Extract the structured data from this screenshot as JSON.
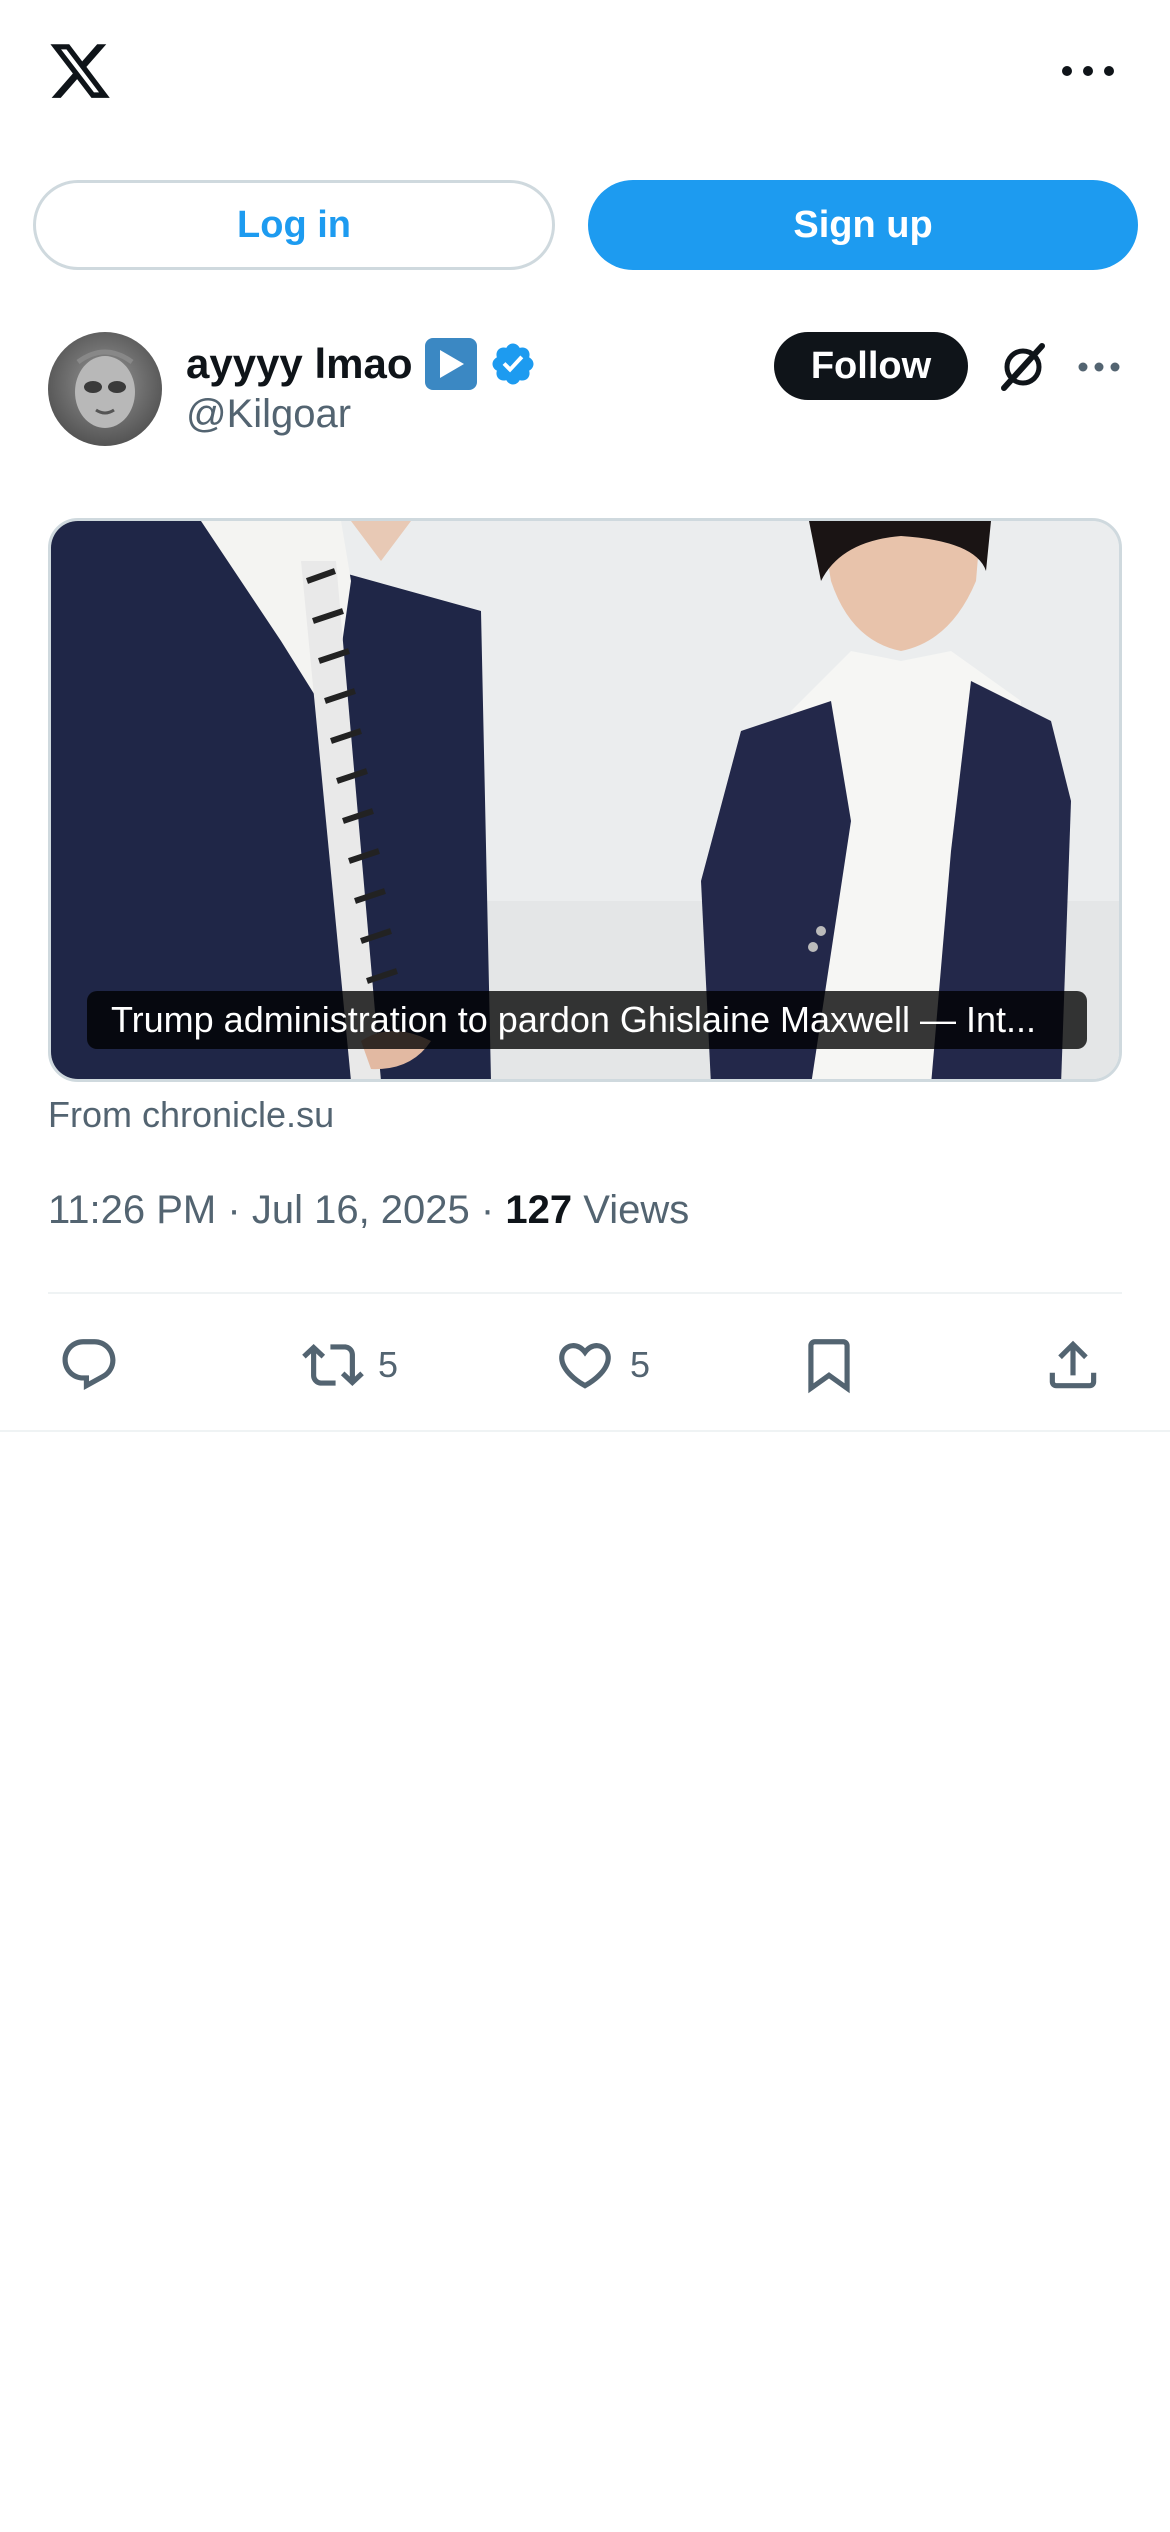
{
  "header": {
    "logo_icon": "x-logo-icon",
    "more_icon": "more-horizontal-icon"
  },
  "auth": {
    "login_label": "Log in",
    "signup_label": "Sign up"
  },
  "author": {
    "display_name": "ayyyy lmao",
    "name_emoji_icon": "play-button-emoji-icon",
    "verified_icon": "verified-badge-icon",
    "handle": "@Kilgoar",
    "follow_label": "Follow",
    "grok_icon": "grok-icon",
    "more_icon": "more-horizontal-icon"
  },
  "card": {
    "caption": "Trump administration to pardon Ghislaine Maxwell — Int...",
    "source": "From chronicle.su"
  },
  "meta": {
    "time": "11:26 PM",
    "separator1": "·",
    "date": "Jul 16, 2025",
    "separator2": "·",
    "views_count": "127",
    "views_label": "Views"
  },
  "actions": {
    "reply_count": "",
    "retweet_count": "5",
    "like_count": "5"
  },
  "colors": {
    "accent": "#1d9bf0",
    "text_primary": "#0f1419",
    "text_secondary": "#536471",
    "border": "#cfd9de"
  }
}
